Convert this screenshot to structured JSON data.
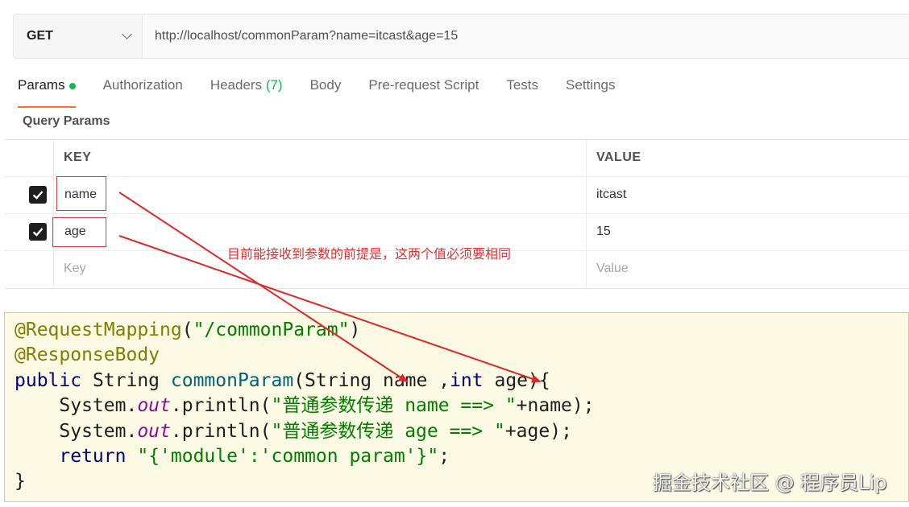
{
  "request": {
    "method": "GET",
    "url": "http://localhost/commonParam?name=itcast&age=15"
  },
  "tabs": [
    {
      "label": "Params",
      "active": true
    },
    {
      "label": "Authorization"
    },
    {
      "label": "Headers",
      "count": "(7)"
    },
    {
      "label": "Body"
    },
    {
      "label": "Pre-request Script"
    },
    {
      "label": "Tests"
    },
    {
      "label": "Settings"
    }
  ],
  "query_params": {
    "title": "Query Params",
    "headers": {
      "key": "KEY",
      "value": "VALUE"
    },
    "rows": [
      {
        "key": "name",
        "value": "itcast",
        "checked": true
      },
      {
        "key": "age",
        "value": "15",
        "checked": true
      }
    ],
    "new_row": {
      "key_placeholder": "Key",
      "value_placeholder": "Value"
    }
  },
  "annotation": "目前能接收到参数的前提是，这两个值必须要相同",
  "code": {
    "line1_annotation": "@RequestMapping",
    "line1_paren_open": "(",
    "line1_string": "\"/commonParam\"",
    "line1_paren_close": ")",
    "line2_annotation": "@ResponseBody",
    "line3_public": "public",
    "line3_type": " String ",
    "line3_method": "commonParam",
    "line3_params_a": "(String name ,",
    "line3_int": "int",
    "line3_params_b": " age){",
    "line4_indent": "    System.",
    "line4_out": "out",
    "line4_call": ".println(",
    "line4_string": "\"普通参数传递 name ==> \"",
    "line4_tail": "+name);",
    "line5_indent": "    System.",
    "line5_out": "out",
    "line5_call": ".println(",
    "line5_string": "\"普通参数传递 age ==> \"",
    "line5_tail": "+age);",
    "line6_indent": "    ",
    "line6_return": "return",
    "line6_space": " ",
    "line6_string": "\"{'module':'common param'}\"",
    "line6_tail": ";",
    "line7": "}"
  },
  "watermark": "掘金技术社区 @ 程序员Lip",
  "colors": {
    "accent": "#ff6c37",
    "status_dot": "#0cbb52",
    "annotation_red": "#e03030"
  }
}
